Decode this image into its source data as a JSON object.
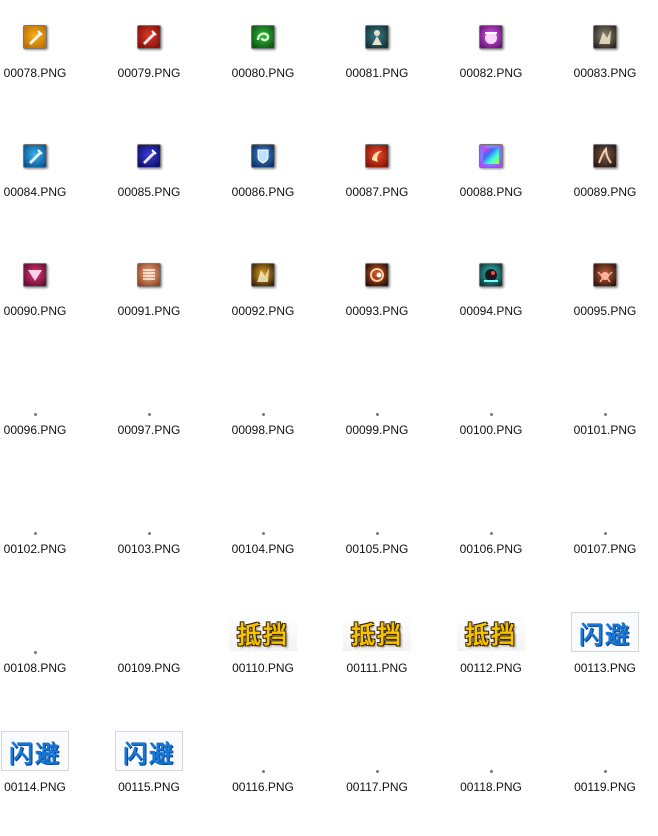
{
  "window": {
    "title": ""
  },
  "files": [
    {
      "name": "00078.PNG",
      "thumb": {
        "kind": "icon",
        "icon": "sword-icon",
        "colors": [
          "#f6b219",
          "#b86a05"
        ]
      }
    },
    {
      "name": "00079.PNG",
      "thumb": {
        "kind": "icon",
        "icon": "sword-icon",
        "colors": [
          "#e03a2a",
          "#7a0f08"
        ]
      }
    },
    {
      "name": "00080.PNG",
      "thumb": {
        "kind": "icon",
        "icon": "swirl-icon",
        "colors": [
          "#2fbf3a",
          "#0b4c12"
        ]
      }
    },
    {
      "name": "00081.PNG",
      "thumb": {
        "kind": "icon",
        "icon": "figure-icon",
        "colors": [
          "#3b7a84",
          "#0f2e33"
        ]
      }
    },
    {
      "name": "00082.PNG",
      "thumb": {
        "kind": "icon",
        "icon": "glow-icon",
        "colors": [
          "#e25ae6",
          "#5a0e72"
        ]
      }
    },
    {
      "name": "00083.PNG",
      "thumb": {
        "kind": "icon",
        "icon": "warrior-icon",
        "colors": [
          "#8f8a78",
          "#222018"
        ]
      }
    },
    {
      "name": "00084.PNG",
      "thumb": {
        "kind": "icon",
        "icon": "sword-icon",
        "colors": [
          "#35b6f0",
          "#0a4a88"
        ]
      }
    },
    {
      "name": "00085.PNG",
      "thumb": {
        "kind": "icon",
        "icon": "sword-icon",
        "colors": [
          "#3a3ee0",
          "#0a0c5c"
        ]
      }
    },
    {
      "name": "00086.PNG",
      "thumb": {
        "kind": "icon",
        "icon": "shield-icon",
        "colors": [
          "#3f8ad6",
          "#0c2a5a"
        ]
      }
    },
    {
      "name": "00087.PNG",
      "thumb": {
        "kind": "icon",
        "icon": "flame-arc-icon",
        "colors": [
          "#f04a2a",
          "#7a1006"
        ]
      }
    },
    {
      "name": "00088.PNG",
      "thumb": {
        "kind": "icon",
        "icon": "rainbow-icon",
        "colors": [
          "#3ad6ff",
          "#b43cff"
        ]
      }
    },
    {
      "name": "00089.PNG",
      "thumb": {
        "kind": "icon",
        "icon": "slash-icon",
        "colors": [
          "#7a5a44",
          "#221510"
        ]
      }
    },
    {
      "name": "00090.PNG",
      "thumb": {
        "kind": "icon",
        "icon": "heart-icon",
        "colors": [
          "#e03a78",
          "#5a0a2a"
        ]
      }
    },
    {
      "name": "00091.PNG",
      "thumb": {
        "kind": "icon",
        "icon": "stripes-icon",
        "colors": [
          "#f0b48a",
          "#8a3a1a"
        ]
      }
    },
    {
      "name": "00092.PNG",
      "thumb": {
        "kind": "icon",
        "icon": "warrior-icon",
        "colors": [
          "#e0a020",
          "#2a1a06"
        ]
      }
    },
    {
      "name": "00093.PNG",
      "thumb": {
        "kind": "icon",
        "icon": "vortex-icon",
        "colors": [
          "#e05a2a",
          "#1a0a06"
        ]
      }
    },
    {
      "name": "00094.PNG",
      "thumb": {
        "kind": "icon",
        "icon": "creature-icon",
        "colors": [
          "#3ac6c6",
          "#0a2a2a"
        ]
      }
    },
    {
      "name": "00095.PNG",
      "thumb": {
        "kind": "icon",
        "icon": "crab-icon",
        "colors": [
          "#c06040",
          "#2a0e08"
        ]
      }
    },
    {
      "name": "00096.PNG",
      "thumb": {
        "kind": "dot"
      }
    },
    {
      "name": "00097.PNG",
      "thumb": {
        "kind": "dot"
      }
    },
    {
      "name": "00098.PNG",
      "thumb": {
        "kind": "dot"
      }
    },
    {
      "name": "00099.PNG",
      "thumb": {
        "kind": "dot"
      }
    },
    {
      "name": "00100.PNG",
      "thumb": {
        "kind": "dot"
      }
    },
    {
      "name": "00101.PNG",
      "thumb": {
        "kind": "dot"
      }
    },
    {
      "name": "00102.PNG",
      "thumb": {
        "kind": "dot"
      }
    },
    {
      "name": "00103.PNG",
      "thumb": {
        "kind": "dot"
      }
    },
    {
      "name": "00104.PNG",
      "thumb": {
        "kind": "dot"
      }
    },
    {
      "name": "00105.PNG",
      "thumb": {
        "kind": "dot"
      }
    },
    {
      "name": "00106.PNG",
      "thumb": {
        "kind": "dot"
      }
    },
    {
      "name": "00107.PNG",
      "thumb": {
        "kind": "dot"
      }
    },
    {
      "name": "00108.PNG",
      "thumb": {
        "kind": "dot"
      }
    },
    {
      "name": "00109.PNG",
      "thumb": {
        "kind": "blank"
      }
    },
    {
      "name": "00110.PNG",
      "thumb": {
        "kind": "banner",
        "style": "gold",
        "text": "抵挡"
      }
    },
    {
      "name": "00111.PNG",
      "thumb": {
        "kind": "banner",
        "style": "gold",
        "text": "抵挡"
      }
    },
    {
      "name": "00112.PNG",
      "thumb": {
        "kind": "banner",
        "style": "gold",
        "text": "抵挡"
      }
    },
    {
      "name": "00113.PNG",
      "thumb": {
        "kind": "banner",
        "style": "blue",
        "text": "闪避"
      }
    },
    {
      "name": "00114.PNG",
      "thumb": {
        "kind": "banner",
        "style": "blue",
        "text": "闪避"
      }
    },
    {
      "name": "00115.PNG",
      "thumb": {
        "kind": "banner",
        "style": "blue",
        "text": "闪避"
      }
    },
    {
      "name": "00116.PNG",
      "thumb": {
        "kind": "dot"
      }
    },
    {
      "name": "00117.PNG",
      "thumb": {
        "kind": "dot"
      }
    },
    {
      "name": "00118.PNG",
      "thumb": {
        "kind": "dot"
      }
    },
    {
      "name": "00119.PNG",
      "thumb": {
        "kind": "dot"
      }
    }
  ]
}
